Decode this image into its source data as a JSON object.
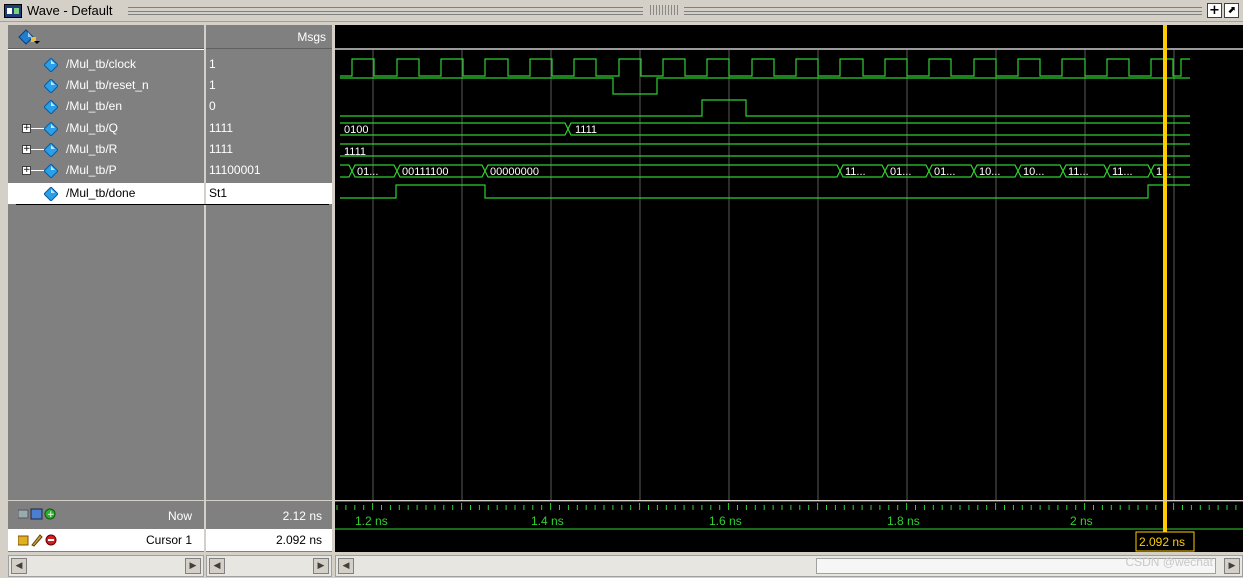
{
  "window": {
    "title": "Wave - Default",
    "icon": "wave-window-icon",
    "buttons": {
      "add": "+",
      "undock": "⬈"
    }
  },
  "header": {
    "msgs_label": "Msgs",
    "toolbar_icon": "signal-dropdown-icon"
  },
  "signals": [
    {
      "name": "/Mul_tb/clock",
      "value": "1",
      "expandable": false
    },
    {
      "name": "/Mul_tb/reset_n",
      "value": "1",
      "expandable": false
    },
    {
      "name": "/Mul_tb/en",
      "value": "0",
      "expandable": false
    },
    {
      "name": "/Mul_tb/Q",
      "value": "1111",
      "expandable": true
    },
    {
      "name": "/Mul_tb/R",
      "value": "1111",
      "expandable": true
    },
    {
      "name": "/Mul_tb/P",
      "value": "11100001",
      "expandable": true
    },
    {
      "name": "/Mul_tb/done",
      "value": "St1",
      "expandable": false,
      "selected": true
    }
  ],
  "bus_labels": {
    "Q": [
      "0100",
      "1111"
    ],
    "R": [
      "1111"
    ],
    "P": [
      "01...",
      "00111100",
      "00000000",
      "11...",
      "01...",
      "01...",
      "10...",
      "10...",
      "11...",
      "11...",
      "1..."
    ]
  },
  "timeline": {
    "now_label": "Now",
    "now_value": "2.12 ns",
    "cursor_label": "Cursor 1",
    "cursor_value": "2.092 ns",
    "tick_labels": [
      "1.2 ns",
      "1.4 ns",
      "1.6 ns",
      "1.8 ns",
      "2 ns"
    ],
    "cursor_marker": "2.092 ns"
  },
  "colors": {
    "wave": "#2fd02f",
    "cursor": "#ffcc00",
    "grid": "#5a5a5a",
    "background": "#000000",
    "signal_icon": "#2aa0e8"
  },
  "watermark": "CSDN @wechat"
}
